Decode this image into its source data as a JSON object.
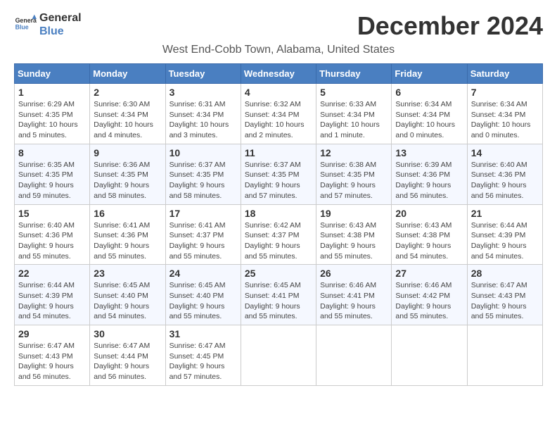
{
  "header": {
    "logo_line1": "General",
    "logo_line2": "Blue",
    "month_year": "December 2024",
    "location": "West End-Cobb Town, Alabama, United States"
  },
  "calendar": {
    "days_of_week": [
      "Sunday",
      "Monday",
      "Tuesday",
      "Wednesday",
      "Thursday",
      "Friday",
      "Saturday"
    ],
    "weeks": [
      [
        {
          "day": "1",
          "sunrise": "6:29 AM",
          "sunset": "4:35 PM",
          "daylight": "10 hours and 5 minutes."
        },
        {
          "day": "2",
          "sunrise": "6:30 AM",
          "sunset": "4:34 PM",
          "daylight": "10 hours and 4 minutes."
        },
        {
          "day": "3",
          "sunrise": "6:31 AM",
          "sunset": "4:34 PM",
          "daylight": "10 hours and 3 minutes."
        },
        {
          "day": "4",
          "sunrise": "6:32 AM",
          "sunset": "4:34 PM",
          "daylight": "10 hours and 2 minutes."
        },
        {
          "day": "5",
          "sunrise": "6:33 AM",
          "sunset": "4:34 PM",
          "daylight": "10 hours and 1 minute."
        },
        {
          "day": "6",
          "sunrise": "6:34 AM",
          "sunset": "4:34 PM",
          "daylight": "10 hours and 0 minutes."
        },
        {
          "day": "7",
          "sunrise": "6:34 AM",
          "sunset": "4:34 PM",
          "daylight": "10 hours and 0 minutes."
        }
      ],
      [
        {
          "day": "8",
          "sunrise": "6:35 AM",
          "sunset": "4:35 PM",
          "daylight": "9 hours and 59 minutes."
        },
        {
          "day": "9",
          "sunrise": "6:36 AM",
          "sunset": "4:35 PM",
          "daylight": "9 hours and 58 minutes."
        },
        {
          "day": "10",
          "sunrise": "6:37 AM",
          "sunset": "4:35 PM",
          "daylight": "9 hours and 58 minutes."
        },
        {
          "day": "11",
          "sunrise": "6:37 AM",
          "sunset": "4:35 PM",
          "daylight": "9 hours and 57 minutes."
        },
        {
          "day": "12",
          "sunrise": "6:38 AM",
          "sunset": "4:35 PM",
          "daylight": "9 hours and 57 minutes."
        },
        {
          "day": "13",
          "sunrise": "6:39 AM",
          "sunset": "4:36 PM",
          "daylight": "9 hours and 56 minutes."
        },
        {
          "day": "14",
          "sunrise": "6:40 AM",
          "sunset": "4:36 PM",
          "daylight": "9 hours and 56 minutes."
        }
      ],
      [
        {
          "day": "15",
          "sunrise": "6:40 AM",
          "sunset": "4:36 PM",
          "daylight": "9 hours and 55 minutes."
        },
        {
          "day": "16",
          "sunrise": "6:41 AM",
          "sunset": "4:36 PM",
          "daylight": "9 hours and 55 minutes."
        },
        {
          "day": "17",
          "sunrise": "6:41 AM",
          "sunset": "4:37 PM",
          "daylight": "9 hours and 55 minutes."
        },
        {
          "day": "18",
          "sunrise": "6:42 AM",
          "sunset": "4:37 PM",
          "daylight": "9 hours and 55 minutes."
        },
        {
          "day": "19",
          "sunrise": "6:43 AM",
          "sunset": "4:38 PM",
          "daylight": "9 hours and 55 minutes."
        },
        {
          "day": "20",
          "sunrise": "6:43 AM",
          "sunset": "4:38 PM",
          "daylight": "9 hours and 54 minutes."
        },
        {
          "day": "21",
          "sunrise": "6:44 AM",
          "sunset": "4:39 PM",
          "daylight": "9 hours and 54 minutes."
        }
      ],
      [
        {
          "day": "22",
          "sunrise": "6:44 AM",
          "sunset": "4:39 PM",
          "daylight": "9 hours and 54 minutes."
        },
        {
          "day": "23",
          "sunrise": "6:45 AM",
          "sunset": "4:40 PM",
          "daylight": "9 hours and 54 minutes."
        },
        {
          "day": "24",
          "sunrise": "6:45 AM",
          "sunset": "4:40 PM",
          "daylight": "9 hours and 55 minutes."
        },
        {
          "day": "25",
          "sunrise": "6:45 AM",
          "sunset": "4:41 PM",
          "daylight": "9 hours and 55 minutes."
        },
        {
          "day": "26",
          "sunrise": "6:46 AM",
          "sunset": "4:41 PM",
          "daylight": "9 hours and 55 minutes."
        },
        {
          "day": "27",
          "sunrise": "6:46 AM",
          "sunset": "4:42 PM",
          "daylight": "9 hours and 55 minutes."
        },
        {
          "day": "28",
          "sunrise": "6:47 AM",
          "sunset": "4:43 PM",
          "daylight": "9 hours and 55 minutes."
        }
      ],
      [
        {
          "day": "29",
          "sunrise": "6:47 AM",
          "sunset": "4:43 PM",
          "daylight": "9 hours and 56 minutes."
        },
        {
          "day": "30",
          "sunrise": "6:47 AM",
          "sunset": "4:44 PM",
          "daylight": "9 hours and 56 minutes."
        },
        {
          "day": "31",
          "sunrise": "6:47 AM",
          "sunset": "4:45 PM",
          "daylight": "9 hours and 57 minutes."
        },
        null,
        null,
        null,
        null
      ]
    ]
  },
  "labels": {
    "sunrise": "Sunrise:",
    "sunset": "Sunset:",
    "daylight": "Daylight:"
  }
}
